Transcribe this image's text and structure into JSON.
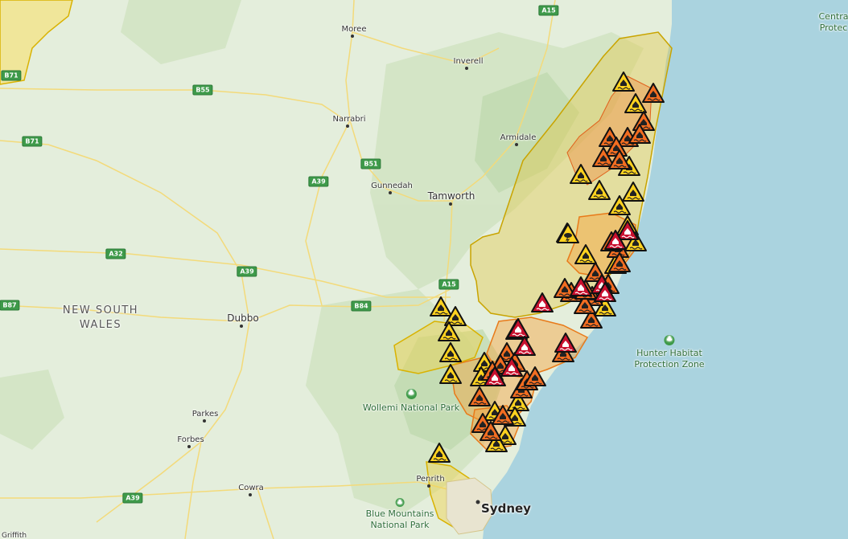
{
  "map": {
    "region_label": [
      "NEW SOUTH",
      "WALES"
    ],
    "colors": {
      "land": "#e4eedc",
      "sea": "#aad3df",
      "watch_zone": "#d9b200",
      "advice": "#ffd21f",
      "watch_and_act": "#f26d21",
      "emergency": "#c8102e",
      "highway_shield": "#3e9a4a",
      "road": "#f3da7a"
    },
    "towns": [
      {
        "name": "Moree"
      },
      {
        "name": "Inverell"
      },
      {
        "name": "Narrabri"
      },
      {
        "name": "Armidale"
      },
      {
        "name": "Gunnedah"
      },
      {
        "name": "Tamworth"
      },
      {
        "name": "Dubbo"
      },
      {
        "name": "Parkes"
      },
      {
        "name": "Forbes"
      },
      {
        "name": "Cowra"
      },
      {
        "name": "Penrith"
      },
      {
        "name": "Griffith"
      }
    ],
    "city": "Sydney",
    "parks": [
      {
        "name": "Wollemi National Park",
        "icon": "park-icon"
      },
      {
        "name": "Hunter Habitat Protection Zone",
        "icon": "park-icon",
        "lines": [
          "Hunter Habitat",
          "Protection Zone"
        ]
      },
      {
        "name": "Blue Mountains National Park",
        "icon": "park-icon",
        "lines": [
          "Blue Mountains",
          "National Park"
        ]
      }
    ],
    "partial_label": [
      "Centra",
      "Protec"
    ],
    "highways": [
      "A15",
      "B71",
      "B55",
      "B71",
      "B51",
      "A39",
      "A32",
      "A39",
      "A15",
      "B84",
      "B87",
      "A39"
    ],
    "warning_icons": {
      "advice": "flood-advice-icon",
      "watch_and_act": "flood-watch-and-act-icon",
      "emergency": "flood-emergency-icon",
      "storm": "storm-icon"
    },
    "warnings": {
      "advice_count": 26,
      "watch_and_act_count": 32,
      "emergency_count": 11,
      "storm_count": 1
    }
  }
}
